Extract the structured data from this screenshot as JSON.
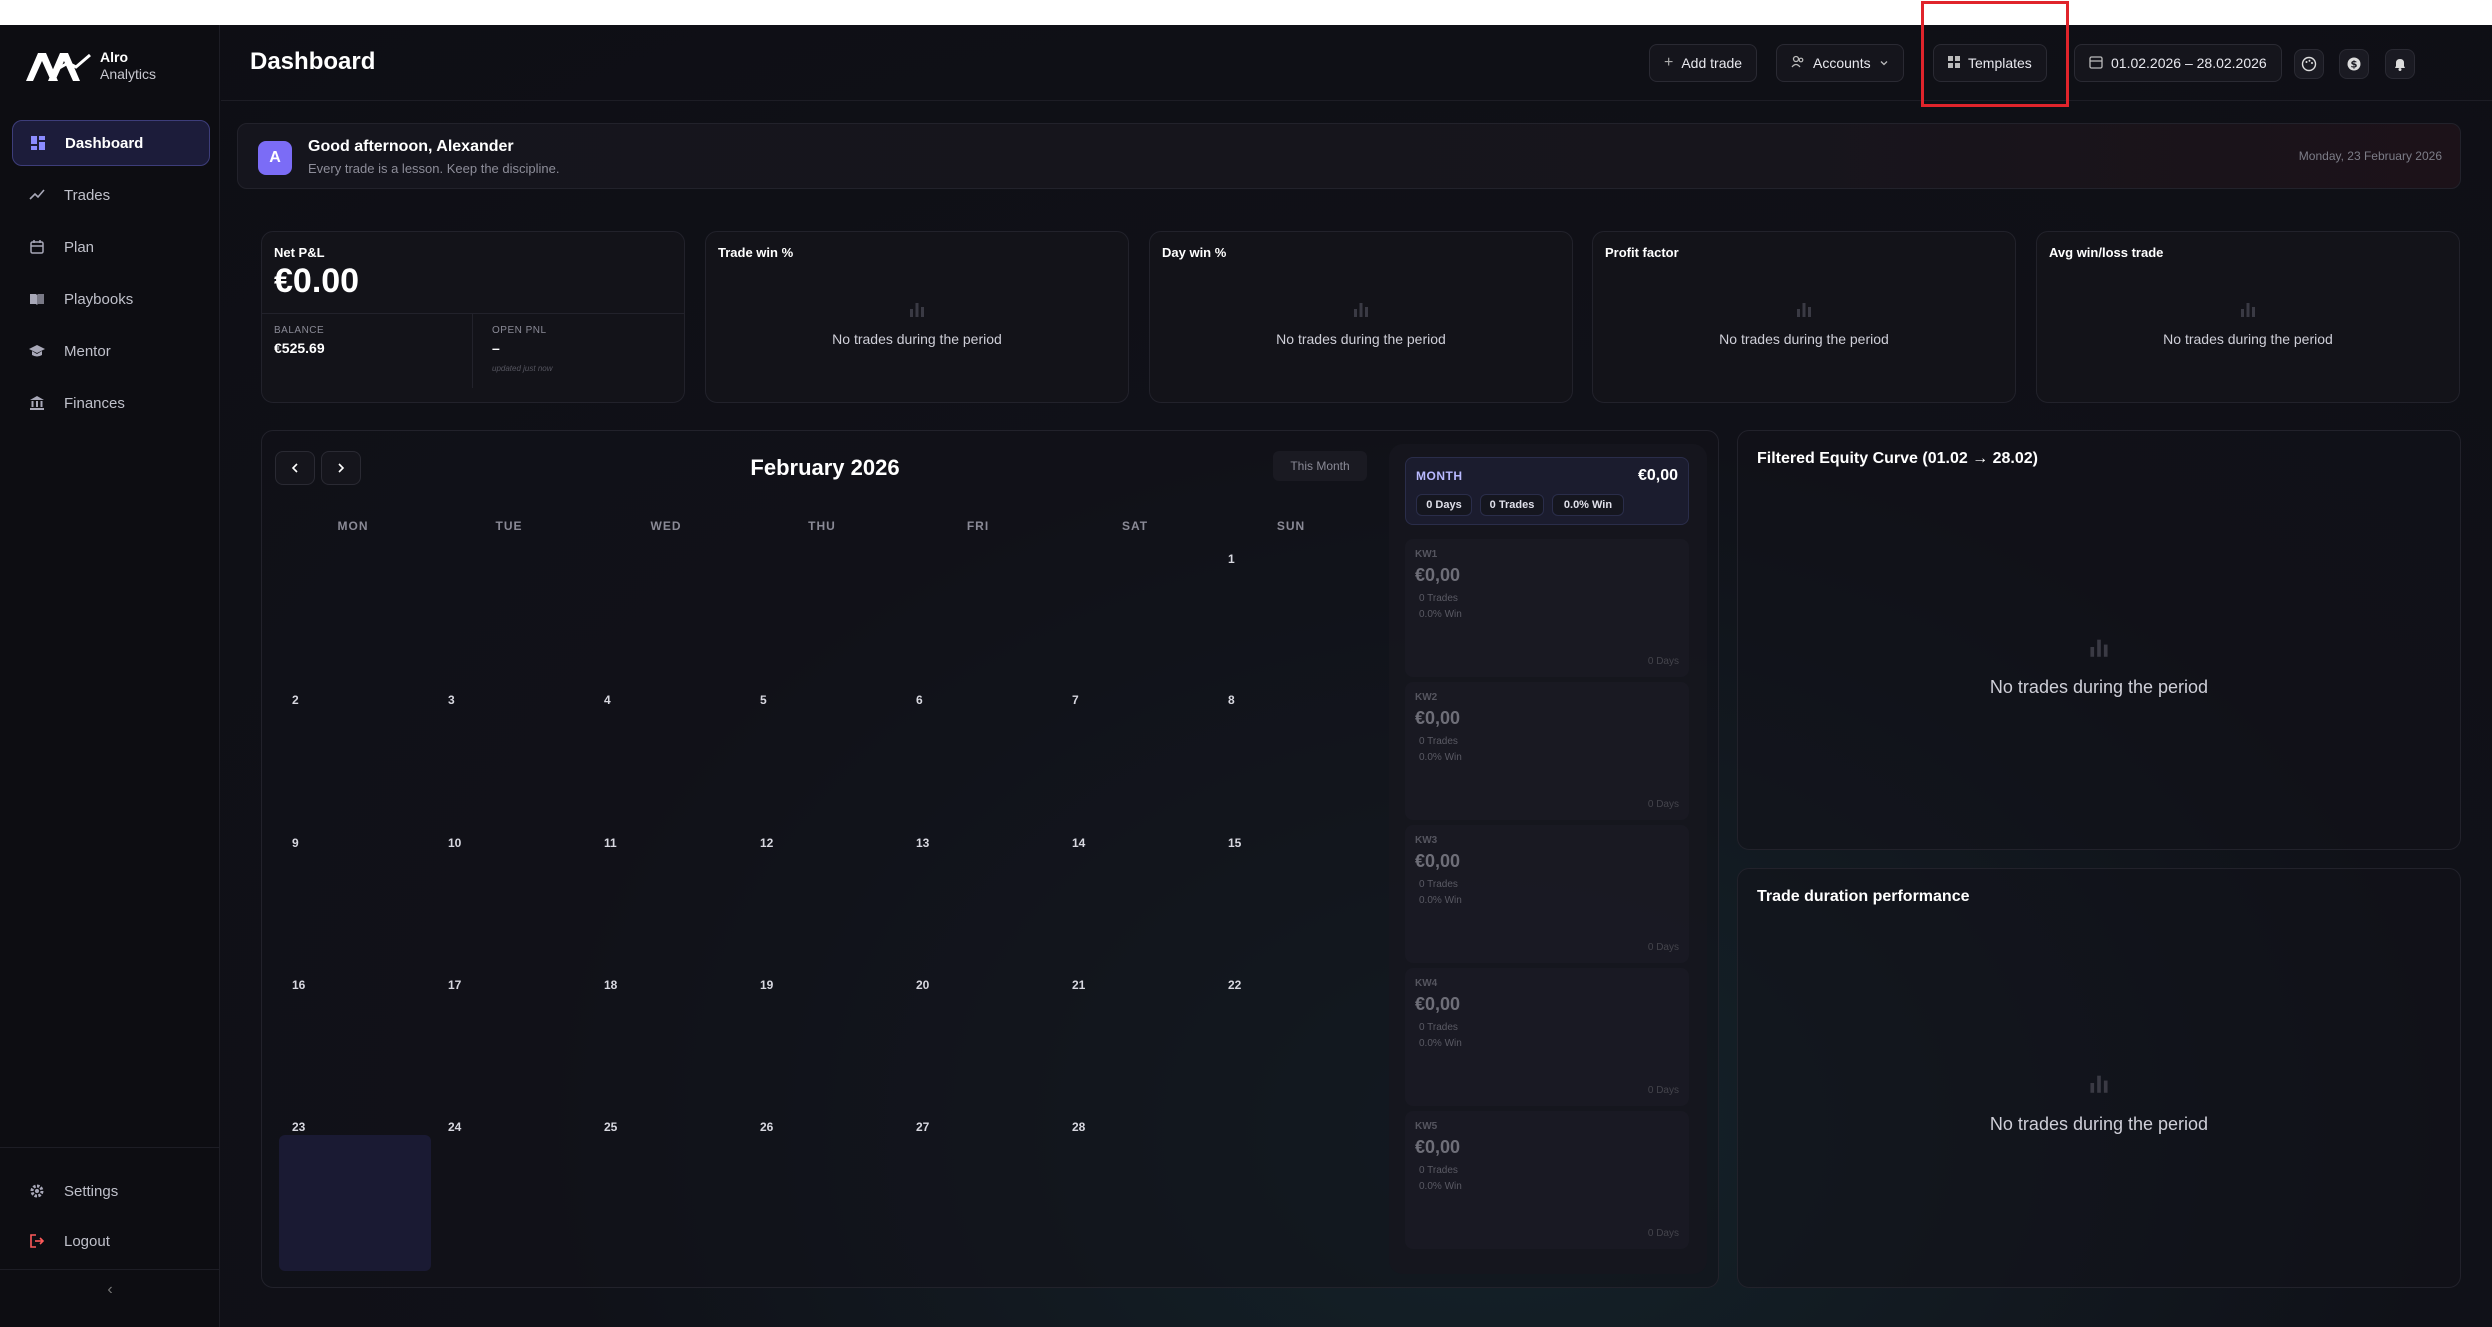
{
  "brand": {
    "name_line1": "Alro",
    "name_line2": "Analytics"
  },
  "sidebar": {
    "items": [
      {
        "label": "Dashboard",
        "icon": "dashboard-grid-icon",
        "active": true
      },
      {
        "label": "Trades",
        "icon": "trend-line-icon"
      },
      {
        "label": "Plan",
        "icon": "calendar-icon"
      },
      {
        "label": "Playbooks",
        "icon": "book-open-icon"
      },
      {
        "label": "Mentor",
        "icon": "graduation-cap-icon"
      },
      {
        "label": "Finances",
        "icon": "bank-icon"
      }
    ],
    "bottom": [
      {
        "label": "Settings",
        "icon": "gear-icon"
      },
      {
        "label": "Logout",
        "icon": "logout-icon"
      }
    ],
    "collapse_glyph": "‹"
  },
  "header": {
    "title": "Dashboard",
    "add_trade": "Add trade",
    "accounts": "Accounts",
    "templates": "Templates",
    "date_range": "01.02.2026 – 28.02.2026"
  },
  "greeting": {
    "avatar_letter": "A",
    "title": "Good afternoon, Alexander",
    "subtitle": "Every trade is a lesson. Keep the discipline.",
    "date": "Monday, 23 February 2026"
  },
  "stats": {
    "net_pnl": {
      "title": "Net P&L",
      "value": "€0.00",
      "balance_label": "BALANCE",
      "balance_value": "€525.69",
      "open_label": "OPEN PNL",
      "open_value": "–",
      "open_note": "updated just now"
    },
    "cards": [
      {
        "title": "Trade win %",
        "empty": "No trades during the period"
      },
      {
        "title": "Day win %",
        "empty": "No trades during the period"
      },
      {
        "title": "Profit factor",
        "empty": "No trades during the period"
      },
      {
        "title": "Avg win/loss trade",
        "empty": "No trades during the period"
      }
    ]
  },
  "calendar": {
    "title": "February 2026",
    "this_month": "This Month",
    "weekdays": [
      "MON",
      "TUE",
      "WED",
      "THU",
      "FRI",
      "SAT",
      "SUN"
    ],
    "days": [
      "1",
      "2",
      "3",
      "4",
      "5",
      "6",
      "7",
      "8",
      "9",
      "10",
      "11",
      "12",
      "13",
      "14",
      "15",
      "16",
      "17",
      "18",
      "19",
      "20",
      "21",
      "22",
      "23",
      "24",
      "25",
      "26",
      "27",
      "28"
    ],
    "today": "23",
    "month_summary": {
      "label": "MONTH",
      "value": "€0,00",
      "days": "0 Days",
      "trades": "0 Trades",
      "win": "0.0% Win"
    },
    "weeks": [
      {
        "label": "KW1",
        "value": "€0,00",
        "trades": "0 Trades",
        "win": "0.0% Win",
        "days": "0 Days"
      },
      {
        "label": "KW2",
        "value": "€0,00",
        "trades": "0 Trades",
        "win": "0.0% Win",
        "days": "0 Days"
      },
      {
        "label": "KW3",
        "value": "€0,00",
        "trades": "0 Trades",
        "win": "0.0% Win",
        "days": "0 Days"
      },
      {
        "label": "KW4",
        "value": "€0,00",
        "trades": "0 Trades",
        "win": "0.0% Win",
        "days": "0 Days"
      },
      {
        "label": "KW5",
        "value": "€0,00",
        "trades": "0 Trades",
        "win": "0.0% Win",
        "days": "0 Days"
      }
    ]
  },
  "equity": {
    "title": "Filtered Equity Curve (01.02 → 28.02)",
    "empty": "No trades during the period"
  },
  "duration": {
    "title": "Trade duration performance",
    "empty": "No trades during the period"
  },
  "colors": {
    "accent": "#6a6cf5",
    "highlight": "#e0242b",
    "logout": "#ff5a5a"
  }
}
